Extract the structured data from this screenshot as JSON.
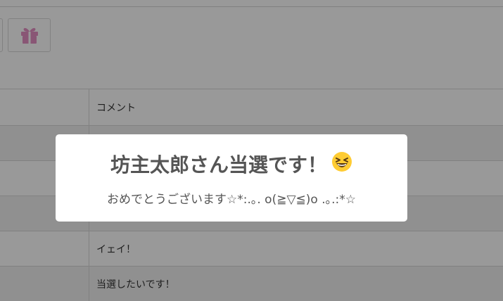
{
  "toolbar": {
    "gift_icon": "gift-icon",
    "gift_color": "#e58fc3"
  },
  "table": {
    "header": {
      "comment_label": "コメント"
    },
    "rows": [
      {
        "comment": ""
      },
      {
        "comment": ""
      },
      {
        "comment": ""
      },
      {
        "comment": "イェイ！"
      },
      {
        "comment": "当選したいです！"
      }
    ]
  },
  "modal": {
    "title": "坊主太郎さん当選です！",
    "title_emoji_icon": "grinning-squinting-face-icon",
    "message": "おめでとうございます☆*:.｡. o(≧▽≦)o .｡.:*☆"
  },
  "colors": {
    "overlay": "rgba(0,0,0,0.40)",
    "modal_background": "#ffffff",
    "text": "#555555"
  }
}
